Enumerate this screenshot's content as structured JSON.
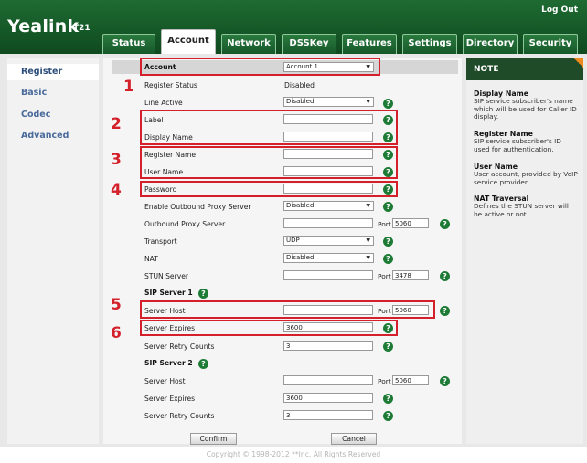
{
  "header": {
    "logo": "Yealink",
    "model": "T21",
    "logout": "Log Out",
    "tabs": [
      "Status",
      "Account",
      "Network",
      "DSSKey",
      "Features",
      "Settings",
      "Directory",
      "Security"
    ]
  },
  "sidebar": {
    "items": [
      "Register",
      "Basic",
      "Codec",
      "Advanced"
    ]
  },
  "form": {
    "account_label": "Account",
    "account_value": "Account 1",
    "register_status_label": "Register Status",
    "register_status_value": "Disabled",
    "line_active_label": "Line Active",
    "line_active_value": "Disabled",
    "label_label": "Label",
    "label_value": "",
    "display_name_label": "Display Name",
    "display_name_value": "",
    "register_name_label": "Register Name",
    "register_name_value": "",
    "user_name_label": "User Name",
    "user_name_value": "",
    "password_label": "Password",
    "password_value": "",
    "outbound_enable_label": "Enable Outbound Proxy Server",
    "outbound_enable_value": "Disabled",
    "outbound_server_label": "Outbound Proxy Server",
    "outbound_server_value": "",
    "outbound_port_label": "Port",
    "outbound_port_value": "5060",
    "transport_label": "Transport",
    "transport_value": "UDP",
    "nat_label": "NAT",
    "nat_value": "Disabled",
    "stun_label": "STUN Server",
    "stun_value": "",
    "stun_port_label": "Port",
    "stun_port_value": "3478",
    "sip1_title": "SIP Server 1",
    "sip1_host_label": "Server Host",
    "sip1_host_value": "",
    "sip1_port_label": "Port",
    "sip1_port_value": "5060",
    "sip1_expires_label": "Server Expires",
    "sip1_expires_value": "3600",
    "sip1_retry_label": "Server Retry Counts",
    "sip1_retry_value": "3",
    "sip2_title": "SIP Server 2",
    "sip2_host_label": "Server Host",
    "sip2_host_value": "",
    "sip2_port_label": "Port",
    "sip2_port_value": "5060",
    "sip2_expires_label": "Server Expires",
    "sip2_expires_value": "3600",
    "sip2_retry_label": "Server Retry Counts",
    "sip2_retry_value": "3",
    "confirm": "Confirm",
    "cancel": "Cancel",
    "help_glyph": "?"
  },
  "annotations": [
    "1",
    "2",
    "3",
    "4",
    "5",
    "6"
  ],
  "note": {
    "title": "NOTE",
    "sections": [
      {
        "title": "Display Name",
        "text": "SIP service subscriber's name which will be used for Caller ID display."
      },
      {
        "title": "Register Name",
        "text": "SIP service subscriber's ID used for authentication."
      },
      {
        "title": "User Name",
        "text": "User account, provided by VoIP service provider."
      },
      {
        "title": "NAT Traversal",
        "text": "Defines the STUN server will be active or not."
      }
    ]
  },
  "footer": {
    "copyright": "Copyright © 1998-2012 **Inc. All Rights Reserved"
  },
  "colors": {
    "header": "#1a5f2c",
    "annotation": "#d4202a",
    "help": "#1e7b35"
  }
}
